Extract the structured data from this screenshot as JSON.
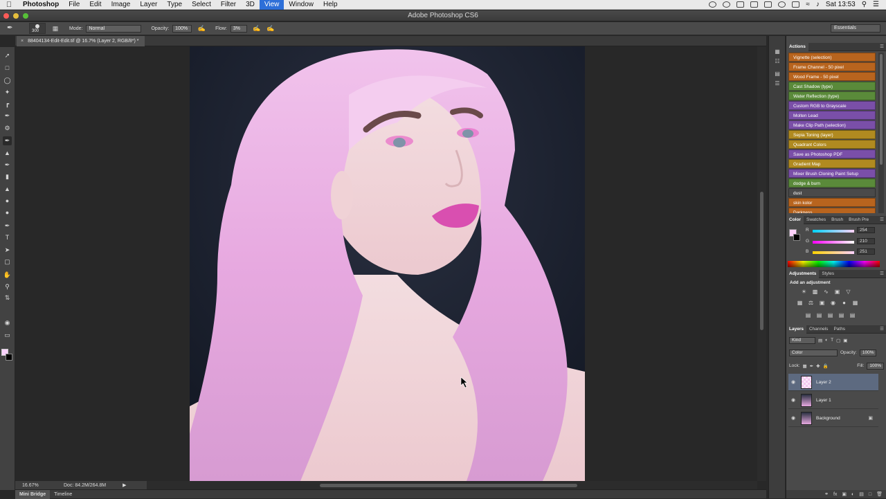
{
  "menubar": {
    "app": "Photoshop",
    "items": [
      "File",
      "Edit",
      "Image",
      "Layer",
      "Type",
      "Select",
      "Filter",
      "3D",
      "View",
      "Window",
      "Help"
    ],
    "active": "View",
    "clock": "Sat 13:53"
  },
  "window": {
    "title": "Adobe Photoshop CS6"
  },
  "options": {
    "brush_size": "300",
    "mode_label": "Mode:",
    "mode_value": "Normal",
    "opacity_label": "Opacity:",
    "opacity_value": "100%",
    "flow_label": "Flow:",
    "flow_value": "3%",
    "workspace": "Essentials"
  },
  "document": {
    "tab_title": "88404134-Edit-Edit.tif @ 16.7% (Layer 2, RGB/8*) *",
    "zoom": "16.67%",
    "doc_size": "Doc: 84.2M/264.8M"
  },
  "bottom_tabs": [
    "Mini Bridge",
    "Timeline"
  ],
  "actions_panel": {
    "tab": "Actions",
    "items": [
      {
        "label": "Vignette (selection)",
        "color": "#b8641e"
      },
      {
        "label": "Frame Channel - 50 pixel",
        "color": "#b8641e"
      },
      {
        "label": "Wood Frame - 50 pixel",
        "color": "#b8641e"
      },
      {
        "label": "Cast Shadow (type)",
        "color": "#5a8a3a"
      },
      {
        "label": "Water Reflection (type)",
        "color": "#5a8a3a"
      },
      {
        "label": "Custom RGB to Grayscale",
        "color": "#7a4fa8"
      },
      {
        "label": "Molten Lead",
        "color": "#7a4fa8"
      },
      {
        "label": "Make Clip Path (selection)",
        "color": "#7a4fa8"
      },
      {
        "label": "Sepia Toning (layer)",
        "color": "#b08a20"
      },
      {
        "label": "Quadrant Colors",
        "color": "#b08a20"
      },
      {
        "label": "Save as Photoshop PDF",
        "color": "#7a4fa8"
      },
      {
        "label": "Gradient Map",
        "color": "#b08a20"
      },
      {
        "label": "Mixer Brush Cloning Paint Setup",
        "color": "#7a4fa8"
      },
      {
        "label": "dodge & burn",
        "color": "#5a8a3a"
      },
      {
        "label": "dust",
        "color": "#4a4a4a"
      },
      {
        "label": "skin kolor",
        "color": "#b8641e"
      },
      {
        "label": "Darkness",
        "color": "#b8641e"
      }
    ]
  },
  "color_panel": {
    "tabs": [
      "Color",
      "Swatches",
      "Brush",
      "Brush Pre"
    ],
    "active": "Color",
    "r_label": "R",
    "r": "254",
    "g_label": "G",
    "g": "210",
    "b_label": "B",
    "b": "251",
    "fg": "#fed2fb"
  },
  "adjustments_panel": {
    "tabs": [
      "Adjustments",
      "Styles"
    ],
    "active": "Adjustments",
    "title": "Add an adjustment"
  },
  "layers_panel": {
    "tabs": [
      "Layers",
      "Channels",
      "Paths"
    ],
    "active": "Layers",
    "kind": "Kind",
    "blend": "Color",
    "opacity_label": "Opacity:",
    "opacity": "100%",
    "lock_label": "Lock:",
    "fill_label": "Fill:",
    "fill": "100%",
    "layers": [
      {
        "name": "Layer 2",
        "selected": true
      },
      {
        "name": "Layer 1",
        "selected": false
      },
      {
        "name": "Background",
        "selected": false
      }
    ]
  }
}
